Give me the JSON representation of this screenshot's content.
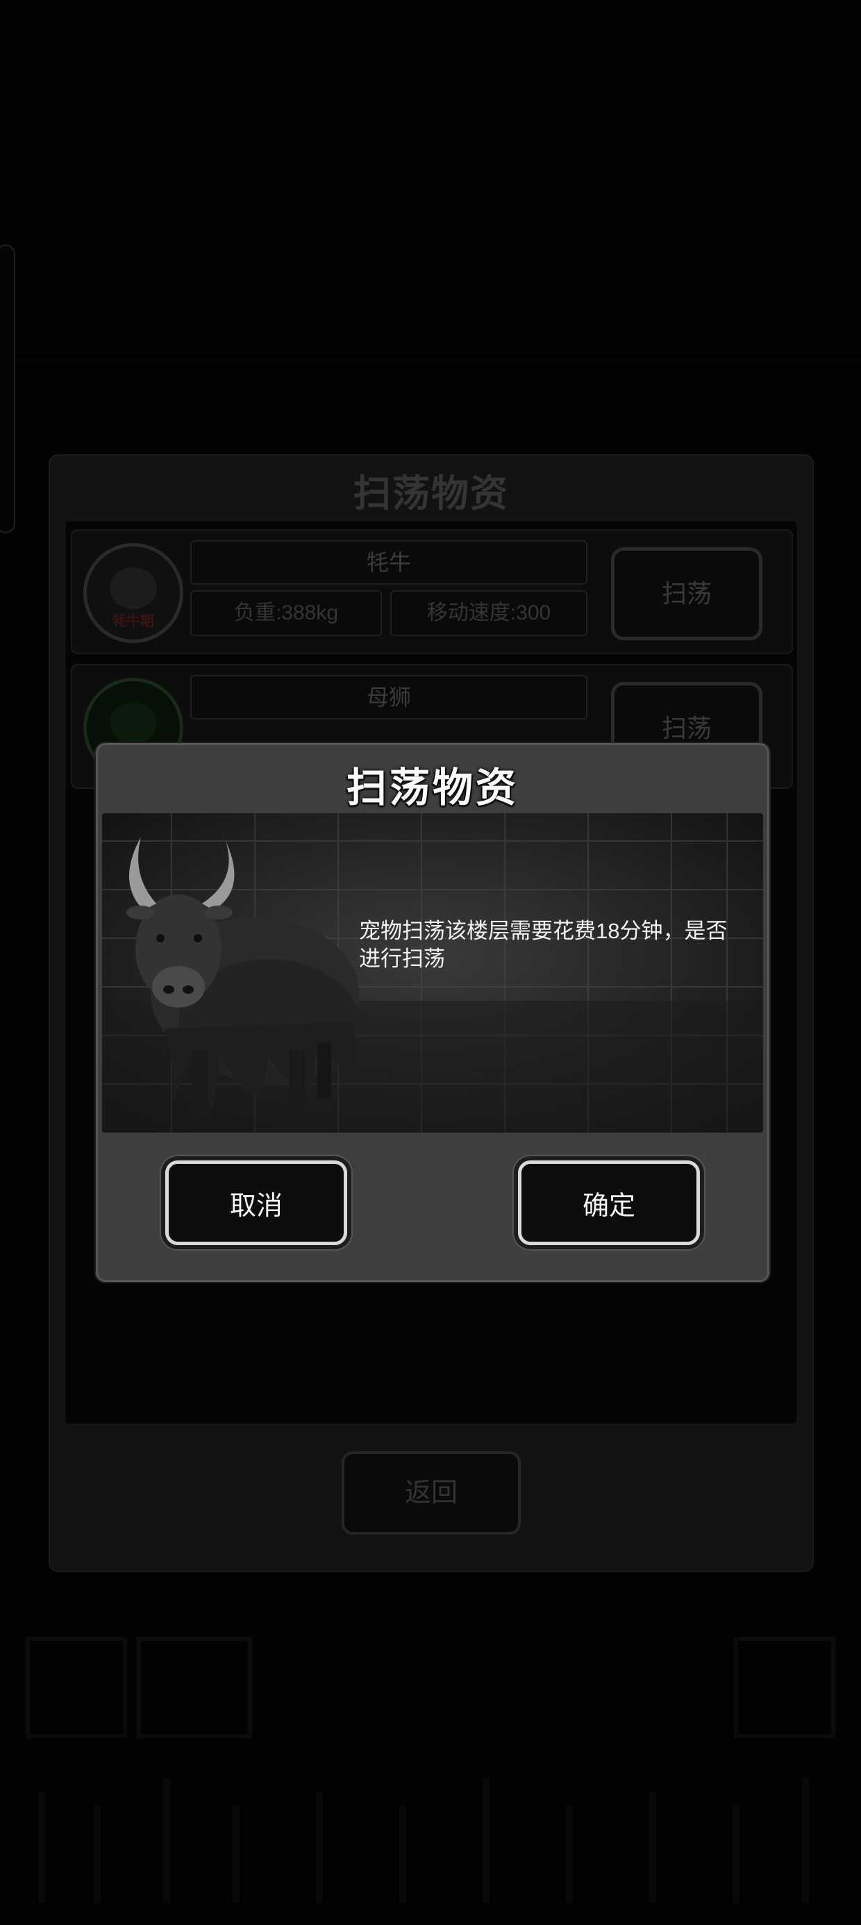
{
  "background_panel": {
    "title": "扫荡物资",
    "pets": [
      {
        "name": "牦牛",
        "avatar_tag": "牦牛期",
        "weight": "负重:388kg",
        "speed": "移动速度:300",
        "sweep_label": "扫荡"
      },
      {
        "name": "母狮",
        "sweep_label": "扫荡"
      }
    ],
    "back_label": "返回"
  },
  "dialog": {
    "title": "扫荡物资",
    "message": "宠物扫荡该楼层需要花费18分钟，是否进行扫荡",
    "cancel_label": "取消",
    "confirm_label": "确定",
    "pet_image_icon": "yak-image"
  }
}
